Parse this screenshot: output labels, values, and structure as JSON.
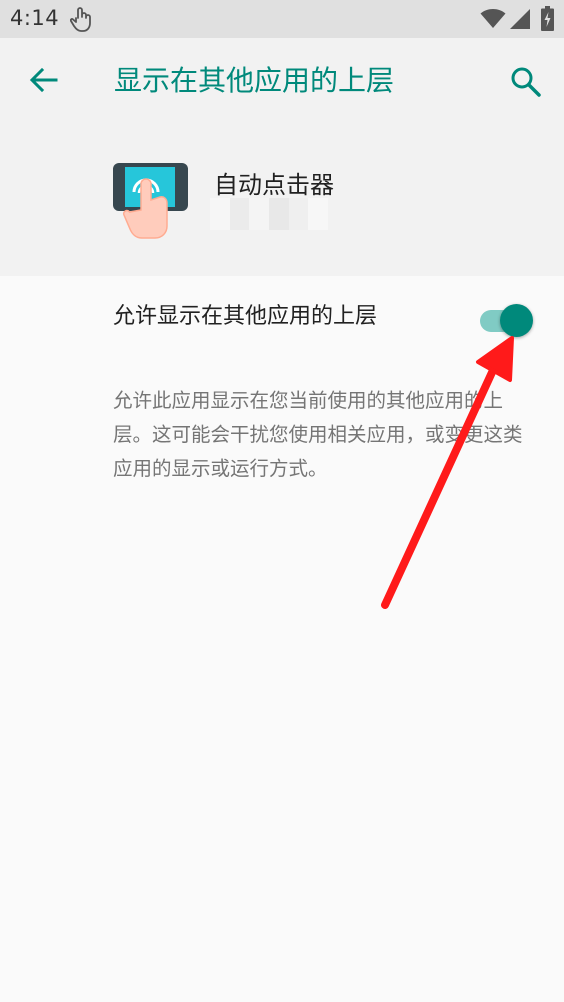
{
  "status_bar": {
    "time": "4:14",
    "icons": [
      "touch-icon",
      "wifi-icon",
      "signal-icon",
      "battery-charging-icon"
    ]
  },
  "toolbar": {
    "title": "显示在其他应用的上层",
    "back_icon": "arrow-back-icon",
    "search_icon": "search-icon",
    "accent_color": "#00897b"
  },
  "app": {
    "name": "自动点击器",
    "icon": "auto-clicker-app-icon"
  },
  "permission": {
    "label": "允许显示在其他应用的上层",
    "enabled": true,
    "description": "允许此应用显示在您当前使用的其他应用的上层。这可能会干扰您使用相关应用，或变更这类应用的显示或运行方式。"
  },
  "annotation": {
    "color": "#ff1a1a",
    "shape": "red-arrow-pointing-to-toggle"
  }
}
